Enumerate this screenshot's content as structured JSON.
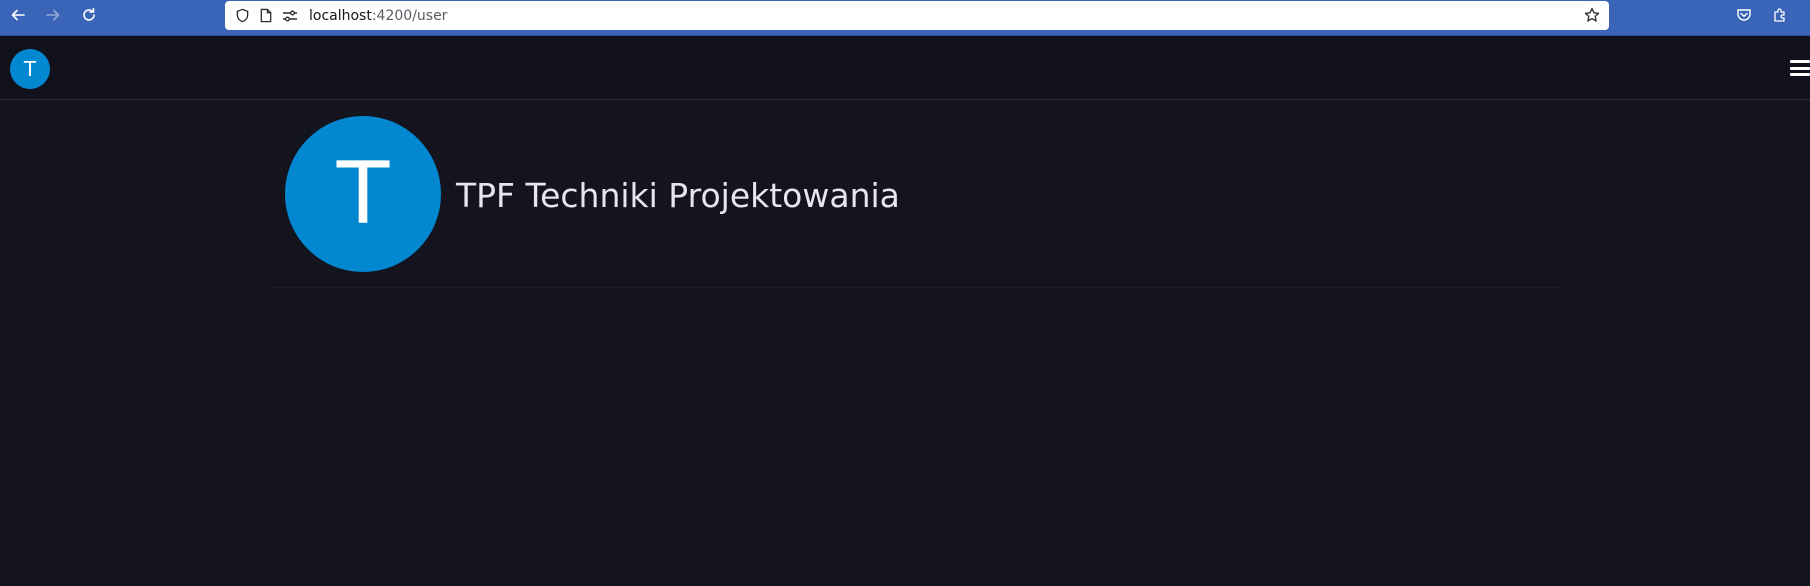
{
  "browser": {
    "url_host": "localhost",
    "url_path": ":4200/user",
    "icons": {
      "back": "arrow-left-icon",
      "forward": "arrow-right-icon",
      "reload": "reload-icon",
      "shield": "shield-icon",
      "page": "page-icon",
      "permissions": "permissions-icon",
      "bookmark": "star-icon",
      "pocket": "pocket-icon",
      "extensions": "extensions-icon"
    }
  },
  "header": {
    "avatar_initial": "T",
    "menu_icon": "hamburger-icon"
  },
  "profile": {
    "avatar_initial": "T",
    "name": "TPF Techniki Projektowania"
  },
  "colors": {
    "background": "#14141f",
    "header_bg": "#11111b",
    "avatar": "#0288d1",
    "browser_bar": "#3a64b8"
  }
}
